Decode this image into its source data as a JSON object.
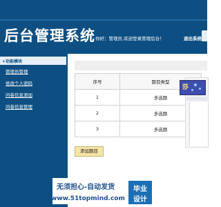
{
  "header": {
    "title": "后台管理系统",
    "welcome": "你好：管理员,欢迎登录管理后台！",
    "logout": "退出系统"
  },
  "sidebar": {
    "section_title": "+功能模块",
    "items": [
      {
        "label": "管理员管理"
      },
      {
        "label": "修改个人密码"
      },
      {
        "label": "问卷信息添加"
      },
      {
        "label": "问卷信息管理"
      }
    ]
  },
  "table": {
    "headers": [
      "序号",
      "题目类型"
    ],
    "rows": [
      {
        "no": "1",
        "type": "多选题"
      },
      {
        "no": "2",
        "type": "多选题"
      },
      {
        "no": "3",
        "type": "多选题"
      }
    ]
  },
  "actions": {
    "add_label": "添加题目"
  },
  "widget": {
    "glyph": "莎"
  },
  "watermark": {
    "line1": "无须担心-自动发货",
    "line2": "www.51topmind.com",
    "badge_top": "毕业",
    "badge_bottom": "设计"
  },
  "colors": {
    "header_bg": "#0d4f82",
    "sidebar_bg": "#0d4f82",
    "button_bg": "#f5e6a8",
    "watermark_text": "#1e4f8c"
  }
}
